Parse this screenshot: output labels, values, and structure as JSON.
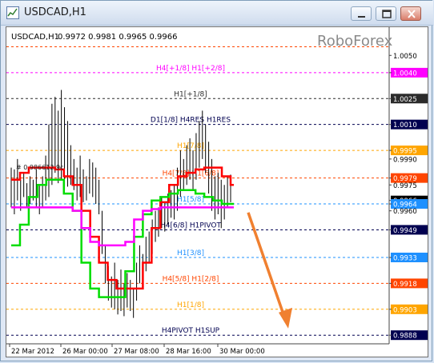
{
  "window": {
    "title": "USDCAD,H1"
  },
  "chart_header": {
    "symbol_tf": "USDCAD,H1",
    "ohlc": "0.9972 0.9981 0.9965 0.9966"
  },
  "watermark": "RoboForex",
  "overlay_label": "# 0.986612.9c",
  "colors": {
    "background": "#ffffff",
    "candles": "#000000",
    "red_line": "#ff0000",
    "green_line": "#00dd00",
    "magenta_line": "#ff00ff",
    "arrow": "#f08030"
  },
  "chart_data": {
    "type": "line",
    "symbol": "USDCAD",
    "timeframe": "H1",
    "ylim": [
      0.9883,
      1.0058
    ],
    "x_ticks": [
      "22 Mar 2012",
      "26 Mar 00:00",
      "27 Mar 08:00",
      "28 Mar 16:00",
      "30 Mar 00:00"
    ],
    "y_ticks": [
      {
        "label": "1.0050",
        "value": 1.005
      },
      {
        "label": "1.0040",
        "value": 1.004,
        "bg": "#ff00ff"
      },
      {
        "label": "1.0025",
        "value": 1.0025,
        "bg": "#2b2b2b"
      },
      {
        "label": "1.0010",
        "value": 1.001,
        "bg": "#000050"
      },
      {
        "label": "0.9995",
        "value": 0.9995,
        "bg": "#ffa500"
      },
      {
        "label": "0.9990",
        "value": 0.999
      },
      {
        "label": "0.9979",
        "value": 0.9979,
        "bg": "#ff4500"
      },
      {
        "label": "0.9975",
        "value": 0.9975
      },
      {
        "label": "0.9966",
        "value": 0.9966,
        "bg": "#000000"
      },
      {
        "label": "0.9964",
        "value": 0.9964,
        "bg": "#1e90ff"
      },
      {
        "label": "0.9960",
        "value": 0.996
      },
      {
        "label": "0.9949",
        "value": 0.9949,
        "bg": "#000050"
      },
      {
        "label": "0.9933",
        "value": 0.9933,
        "bg": "#1e90ff"
      },
      {
        "label": "0.9918",
        "value": 0.9918,
        "bg": "#ff4500"
      },
      {
        "label": "0.9903",
        "value": 0.9903,
        "bg": "#ffa500"
      },
      {
        "label": "0.9888",
        "value": 0.9888,
        "bg": "#000050"
      }
    ],
    "levels": [
      {
        "value": 1.0055,
        "label": "",
        "color": "#ff4500"
      },
      {
        "value": 1.004,
        "label": "H4[+1/8] H1[+2/8]",
        "color": "#ff00ff"
      },
      {
        "value": 1.0025,
        "label": "H1[+1/8]",
        "color": "#2b2b2b"
      },
      {
        "value": 1.001,
        "label": "D1[1/8] H4RES H1RES",
        "color": "#000050"
      },
      {
        "value": 0.9995,
        "label": "H1[7/8]",
        "color": "#ffa500"
      },
      {
        "value": 0.9979,
        "label": "H4[7/8] H1[6/8]",
        "color": "#ff4500"
      },
      {
        "value": 0.9964,
        "label": "H1[5/8]",
        "color": "#1e90ff"
      },
      {
        "value": 0.9949,
        "label": "H4[6/8] H1PIVOT",
        "color": "#000050"
      },
      {
        "value": 0.9933,
        "label": "H1[3/8]",
        "color": "#1e90ff"
      },
      {
        "value": 0.9918,
        "label": "H4[5/8] H1[2/8]",
        "color": "#ff4500"
      },
      {
        "value": 0.9903,
        "label": "H1[1/8]",
        "color": "#ffa500"
      },
      {
        "value": 0.9888,
        "label": "H4PIVOT H1SUP",
        "color": "#000050"
      }
    ],
    "price_bars": [
      {
        "h": 0.9985,
        "l": 0.9962
      },
      {
        "h": 0.9984,
        "l": 0.9958
      },
      {
        "h": 0.999,
        "l": 0.9966
      },
      {
        "h": 0.9978,
        "l": 0.996
      },
      {
        "h": 0.9982,
        "l": 0.9968
      },
      {
        "h": 0.9976,
        "l": 0.9962
      },
      {
        "h": 0.998,
        "l": 0.9964
      },
      {
        "h": 0.9978,
        "l": 0.9966
      },
      {
        "h": 0.9984,
        "l": 0.9962
      },
      {
        "h": 0.9975,
        "l": 0.9958
      },
      {
        "h": 0.998,
        "l": 0.9962
      },
      {
        "h": 0.9992,
        "l": 0.9966
      },
      {
        "h": 1.001,
        "l": 0.9968
      },
      {
        "h": 1.0022,
        "l": 0.9975
      },
      {
        "h": 1.0026,
        "l": 0.9982
      },
      {
        "h": 1.0018,
        "l": 0.9976
      },
      {
        "h": 1.003,
        "l": 0.9978
      },
      {
        "h": 1.002,
        "l": 0.9972
      },
      {
        "h": 1.0012,
        "l": 0.9974
      },
      {
        "h": 0.9998,
        "l": 0.9975
      },
      {
        "h": 0.999,
        "l": 0.9972
      },
      {
        "h": 0.9985,
        "l": 0.9966
      },
      {
        "h": 0.9992,
        "l": 0.9968
      },
      {
        "h": 0.9984,
        "l": 0.9965
      },
      {
        "h": 0.998,
        "l": 0.9966
      },
      {
        "h": 0.999,
        "l": 0.997
      },
      {
        "h": 0.9988,
        "l": 0.9968
      },
      {
        "h": 0.9985,
        "l": 0.9964
      },
      {
        "h": 0.9978,
        "l": 0.9958
      },
      {
        "h": 0.996,
        "l": 0.9935
      },
      {
        "h": 0.994,
        "l": 0.9918
      },
      {
        "h": 0.9928,
        "l": 0.9908
      },
      {
        "h": 0.9922,
        "l": 0.9904
      },
      {
        "h": 0.993,
        "l": 0.9903
      },
      {
        "h": 0.992,
        "l": 0.99
      },
      {
        "h": 0.9926,
        "l": 0.9902
      },
      {
        "h": 0.9918,
        "l": 0.9899
      },
      {
        "h": 0.9924,
        "l": 0.9904
      },
      {
        "h": 0.992,
        "l": 0.9902
      },
      {
        "h": 0.9915,
        "l": 0.9898
      },
      {
        "h": 0.993,
        "l": 0.9908
      },
      {
        "h": 0.994,
        "l": 0.9918
      },
      {
        "h": 0.9935,
        "l": 0.9915
      },
      {
        "h": 0.9945,
        "l": 0.9925
      },
      {
        "h": 0.9948,
        "l": 0.993
      },
      {
        "h": 0.9955,
        "l": 0.9935
      },
      {
        "h": 0.996,
        "l": 0.9942
      },
      {
        "h": 0.9962,
        "l": 0.9945
      },
      {
        "h": 0.9968,
        "l": 0.995
      },
      {
        "h": 0.9965,
        "l": 0.9948
      },
      {
        "h": 0.997,
        "l": 0.9952
      },
      {
        "h": 0.9972,
        "l": 0.9956
      },
      {
        "h": 0.9975,
        "l": 0.9955
      },
      {
        "h": 0.9985,
        "l": 0.996
      },
      {
        "h": 0.9995,
        "l": 0.9968
      },
      {
        "h": 0.999,
        "l": 0.9972
      },
      {
        "h": 0.9998,
        "l": 0.9975
      },
      {
        "h": 1.0002,
        "l": 0.9978
      },
      {
        "h": 0.9995,
        "l": 0.9972
      },
      {
        "h": 1.0005,
        "l": 0.9978
      },
      {
        "h": 1.0012,
        "l": 0.9985
      },
      {
        "h": 1.0018,
        "l": 0.999
      },
      {
        "h": 1.001,
        "l": 0.9982
      },
      {
        "h": 1.0,
        "l": 0.997
      },
      {
        "h": 0.999,
        "l": 0.996
      },
      {
        "h": 0.998,
        "l": 0.9955
      },
      {
        "h": 0.9982,
        "l": 0.9958
      },
      {
        "h": 0.9978,
        "l": 0.995
      },
      {
        "h": 0.9975,
        "l": 0.9955
      },
      {
        "h": 0.998,
        "l": 0.9962
      },
      {
        "h": 0.9981,
        "l": 0.9965
      }
    ],
    "series": [
      {
        "color": "#ff0000",
        "values": [
          0.9978,
          0.9982,
          0.9985,
          0.9985,
          0.9985,
          0.9984,
          0.998,
          0.9975,
          0.996,
          0.9945,
          0.993,
          0.992,
          0.9915,
          0.9915,
          0.9915,
          0.993,
          0.995,
          0.9965,
          0.9975,
          0.998,
          0.9982,
          0.9984,
          0.9985,
          0.9985,
          0.998,
          0.9975
        ]
      },
      {
        "color": "#00dd00",
        "values": [
          0.994,
          0.9952,
          0.9968,
          0.9975,
          0.9978,
          0.9978,
          0.997,
          0.996,
          0.993,
          0.9915,
          0.991,
          0.991,
          0.991,
          0.9925,
          0.9945,
          0.9958,
          0.9966,
          0.9968,
          0.997,
          0.9972,
          0.9972,
          0.997,
          0.9968,
          0.9966,
          0.9964,
          0.9964
        ]
      },
      {
        "color": "#ff00ff",
        "values": [
          0.9962,
          0.9962,
          0.9962,
          0.9962,
          0.9962,
          0.9962,
          0.9962,
          0.996,
          0.995,
          0.9942,
          0.994,
          0.994,
          0.994,
          0.9942,
          0.9955,
          0.996,
          0.9961,
          0.9962,
          0.9962,
          0.9962,
          0.9962,
          0.9962,
          0.9962,
          0.9962,
          0.9962,
          0.9962
        ]
      }
    ],
    "forecast_arrow": {
      "from": 0.9972,
      "to": 0.989,
      "direction": "down"
    }
  }
}
